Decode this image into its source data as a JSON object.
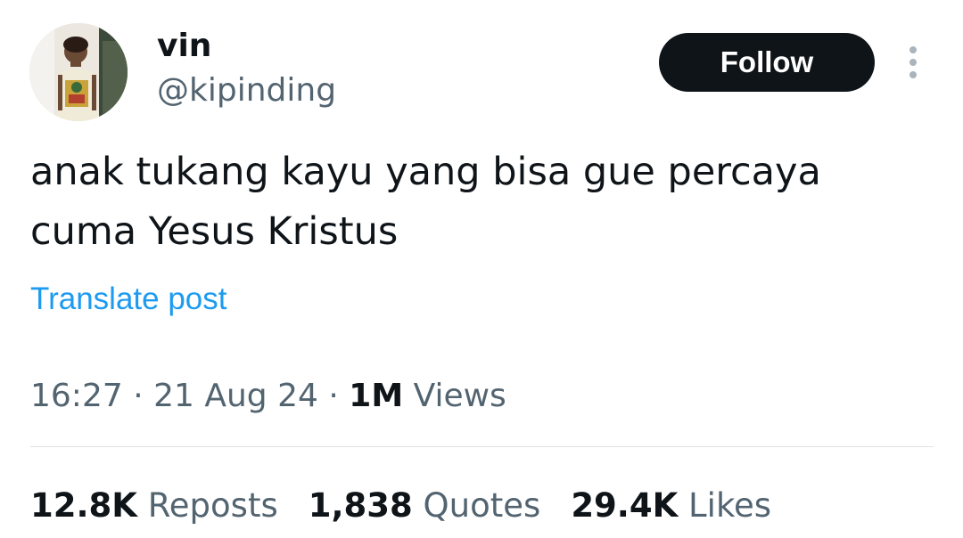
{
  "author": {
    "display_name": "vin",
    "handle": "@kipinding",
    "avatar_icon": "profile-photo"
  },
  "actions": {
    "follow_label": "Follow",
    "more_icon": "vertical-ellipsis-icon"
  },
  "post": {
    "text": "anak tukang kayu yang bisa gue percaya\ncuma Yesus Kristus",
    "translate_label": "Translate post"
  },
  "meta": {
    "time": "16:27",
    "separator": "·",
    "date": "21 Aug 24",
    "views_count": "1M",
    "views_label": "Views"
  },
  "stats": [
    {
      "count": "12.8K",
      "label": "Reposts"
    },
    {
      "count": "1,838",
      "label": "Quotes"
    },
    {
      "count": "29.4K",
      "label": "Likes"
    }
  ],
  "colors": {
    "text_primary": "#0f1419",
    "text_secondary": "#536471",
    "link": "#1d9bf0",
    "follow_bg": "#0f1419",
    "divider": "#dfe3e6"
  }
}
